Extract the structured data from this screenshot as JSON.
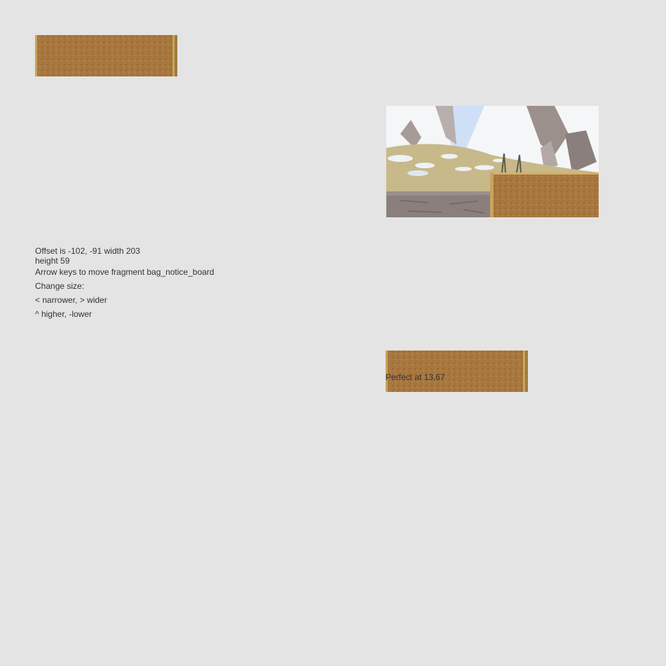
{
  "info": {
    "offset_line": "Offset is -102, -91 width 203",
    "height_line": "height 59",
    "instructions": "Arrow keys to move fragment bag_notice_board",
    "change_size": "Change size:",
    "width_controls": "< narrower, > wider",
    "height_controls": "^ higher, -lower"
  },
  "result": {
    "perfect_text": "Perfect at 13,67"
  },
  "colors": {
    "background": "#e5e4e4",
    "cork": "#a8773f",
    "frame": "#c9a45a",
    "sky": "#cfe0f6",
    "snow": "#f4f6f8",
    "rock": "#8a7f7d",
    "grass": "#c7b98a",
    "text": "#333333"
  },
  "icons": {
    "fragment": "cork-board-fragment",
    "scene": "snowy-mountain-scene"
  }
}
